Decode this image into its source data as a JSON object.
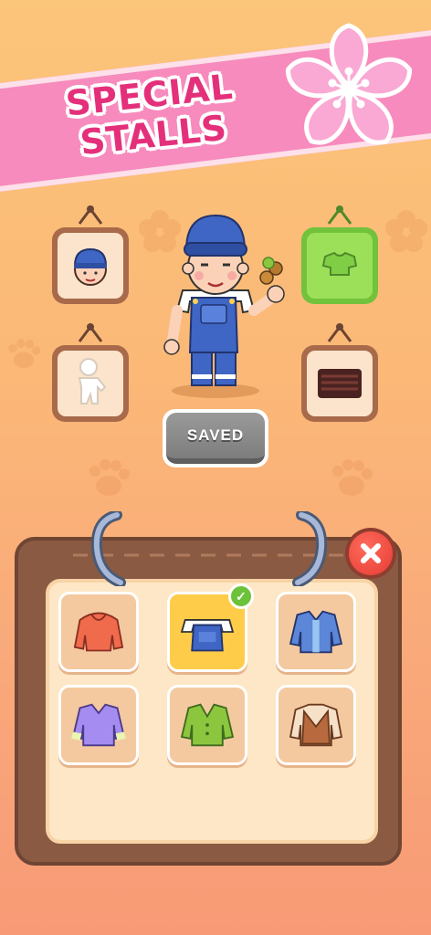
{
  "banner": {
    "title": "SPECIAL STALLS"
  },
  "avatar_frames": [
    {
      "name": "head-portrait",
      "icon": "head-portrait-icon"
    },
    {
      "name": "top-clothing",
      "icon": "crop-top-icon"
    },
    {
      "name": "body-silhouette",
      "icon": "body-silhouette-icon"
    },
    {
      "name": "stall-item",
      "icon": "grill-icon"
    }
  ],
  "buttons": {
    "saved_label": "SAVED",
    "close_icon": "close-icon"
  },
  "wardrobe": {
    "items": [
      {
        "name": "red-hoodie",
        "icon": "hoodie-icon",
        "color": "#f06a4c",
        "selected": false
      },
      {
        "name": "blue-overalls",
        "icon": "overalls-icon",
        "color": "#3f66c4",
        "selected": true
      },
      {
        "name": "denim-jacket",
        "icon": "jacket-icon",
        "color": "#5c86d8",
        "selected": false
      },
      {
        "name": "purple-jacket",
        "icon": "jacket-icon",
        "color": "#a58cf0",
        "selected": false
      },
      {
        "name": "green-cardigan",
        "icon": "cardigan-icon",
        "color": "#8cc63e",
        "selected": false
      },
      {
        "name": "brown-vest",
        "icon": "vest-icon",
        "color": "#b86a3e",
        "selected": false
      }
    ]
  },
  "colors": {
    "accent_pink": "#f78bbd",
    "title_pink": "#e4307a",
    "frame_brown": "#a86a4a",
    "selected_green": "#72c23c"
  }
}
